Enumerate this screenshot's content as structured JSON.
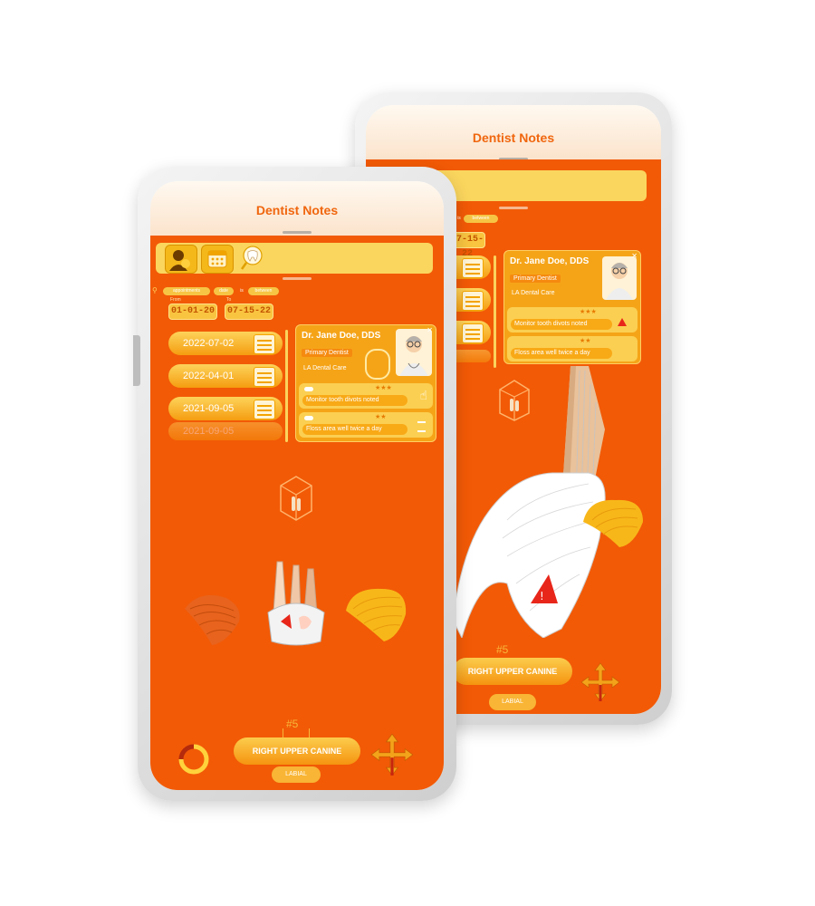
{
  "app": {
    "title": "Dentist Notes"
  },
  "filters": {
    "chips": [
      "appointments",
      "date",
      "is",
      "between"
    ],
    "from_label": "From",
    "to_label": "To",
    "from_date": "01-01-20",
    "to_date": "07-15-22"
  },
  "appointments": [
    "2022-07-02",
    "2022-04-01",
    "2021-09-05",
    "2021-09-05"
  ],
  "dentist": {
    "name": "Dr. Jane Doe, DDS",
    "role": "Primary Dentist",
    "clinic": "LA Dental Care"
  },
  "notes": [
    {
      "text": "Monitor tooth divots noted",
      "stars": "★★★"
    },
    {
      "text": "Floss area well twice a day",
      "stars": "★★"
    }
  ],
  "tooth": {
    "number": "#5",
    "name": "RIGHT UPPER CANINE",
    "surface": "LABIAL"
  },
  "icons": {
    "patient": "patient-icon",
    "calendar": "calendar-icon",
    "tooth_search": "tooth-search-icon",
    "refresh": "refresh-icon",
    "move": "move-arrows-icon",
    "warning": "warning-icon",
    "close": "close-icon"
  },
  "colors": {
    "screen": "#f25a06",
    "accent": "#fbd65e",
    "title": "#f0660e",
    "warning": "#e8261a"
  }
}
